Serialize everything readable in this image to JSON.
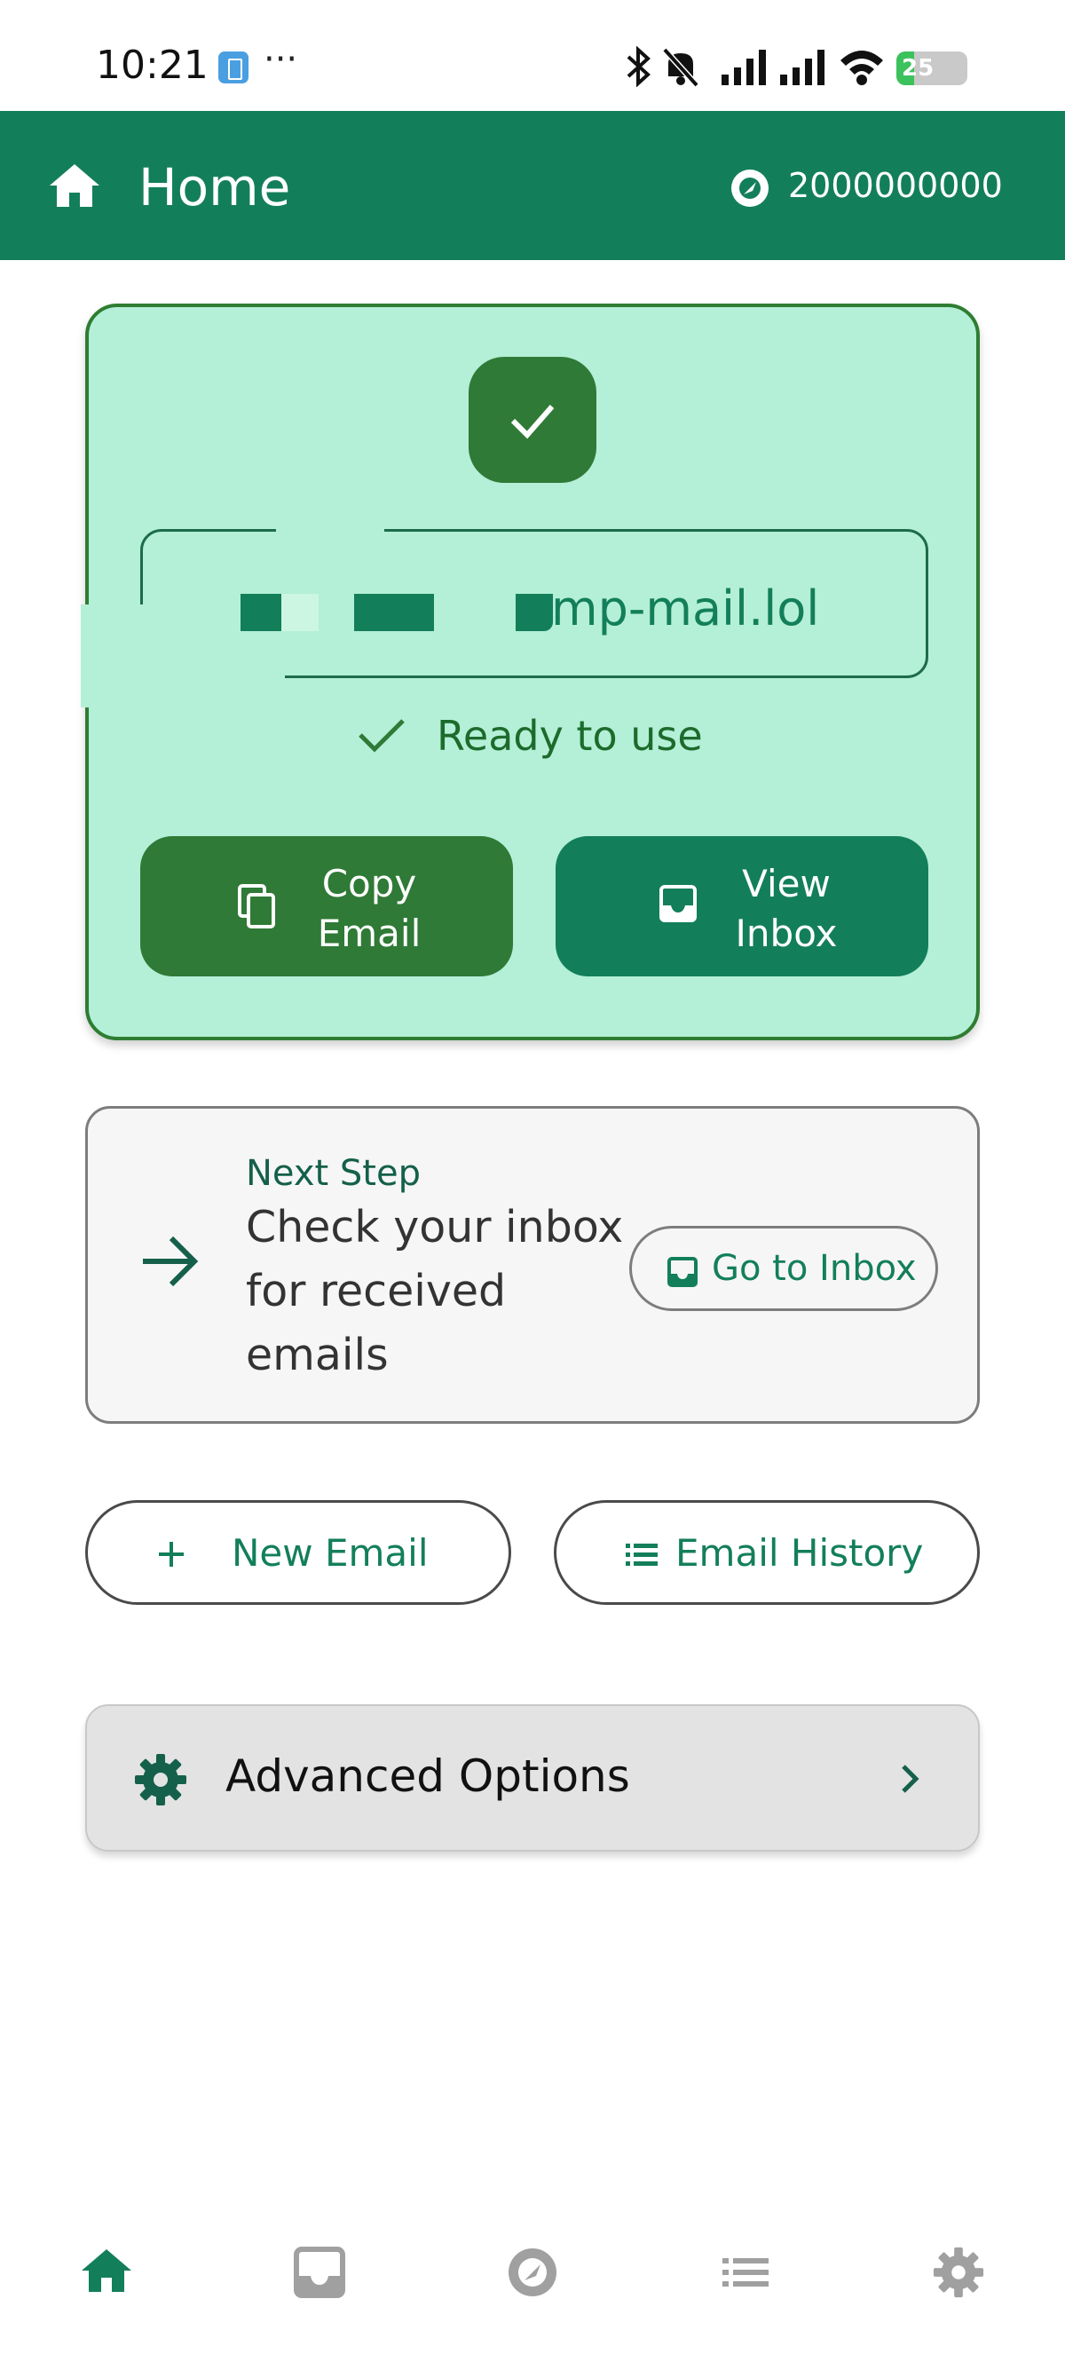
{
  "status_bar": {
    "time": "10:21",
    "more": "···",
    "battery_percent": 25,
    "battery_label": "25"
  },
  "app_bar": {
    "title": "Home",
    "credits": "2000000000"
  },
  "email_card": {
    "email_visible_suffix": "mp-mail.lol",
    "status": "Ready to use",
    "copy_button": {
      "line1": "Copy",
      "line2": "Email"
    },
    "inbox_button": {
      "line1": "View",
      "line2": "Inbox"
    }
  },
  "next_step": {
    "title": "Next Step",
    "description_lines": [
      "Check your inbox",
      "for received",
      "emails"
    ],
    "button_label": "Go to Inbox"
  },
  "actions": {
    "new_email": "New Email",
    "email_history": "Email History"
  },
  "advanced": {
    "label": "Advanced Options"
  },
  "bottom_nav": {
    "items": [
      "home-icon",
      "inbox-icon",
      "credits-icon",
      "list-icon",
      "settings-icon"
    ],
    "active_index": 0,
    "active_color": "#137f5a",
    "inactive_color": "#a0a0a0"
  },
  "colors": {
    "brand": "#137f5a",
    "card_bg": "#b4efd7",
    "button_dark_green": "#2f7a36"
  }
}
